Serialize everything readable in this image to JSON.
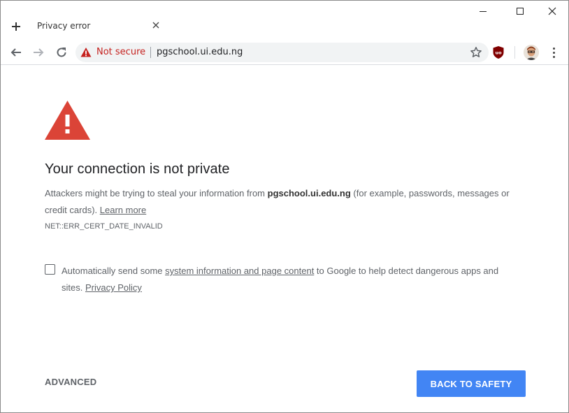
{
  "tab": {
    "title": "Privacy error"
  },
  "toolbar": {
    "security_label": "Not secure",
    "url": "pgschool.ui.edu.ng"
  },
  "page": {
    "heading": "Your connection is not private",
    "desc_prefix": "Attackers might be trying to steal your information from ",
    "desc_domain": "pgschool.ui.edu.ng",
    "desc_suffix": " (for example, passwords, messages or credit cards). ",
    "learn_more": "Learn more",
    "error_code": "NET::ERR_CERT_DATE_INVALID",
    "checkbox_prefix": "Automatically send some ",
    "checkbox_link": "system information and page content",
    "checkbox_middle": " to Google to help detect dangerous apps and sites. ",
    "privacy_policy": "Privacy Policy",
    "advanced_label": "ADVANCED",
    "safety_label": "BACK TO SAFETY"
  },
  "colors": {
    "warning_red": "#db4437",
    "primary_blue": "#4285f4",
    "insecure_red": "#c5221f"
  },
  "icons": [
    "plus-icon",
    "close-icon",
    "minimize-icon",
    "maximize-icon",
    "back-arrow-icon",
    "forward-arrow-icon",
    "reload-icon",
    "warning-triangle-icon",
    "star-icon",
    "ublock-icon",
    "avatar-icon",
    "kebab-menu-icon"
  ]
}
